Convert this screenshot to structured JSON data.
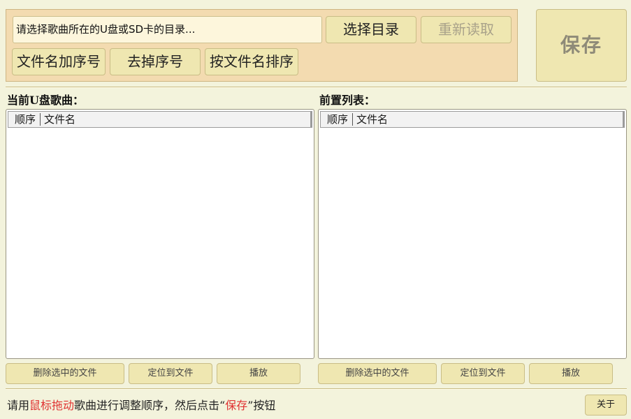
{
  "toolbar": {
    "path_text": "请选择歌曲所在的U盘或SD卡的目录...",
    "choose_dir": "选择目录",
    "reload": "重新读取",
    "add_index": "文件名加序号",
    "remove_index": "去掉序号",
    "sort_by_name": "按文件名排序",
    "save": "保存"
  },
  "left_panel": {
    "title": "当前U盘歌曲：",
    "col_order": "顺序",
    "col_name": "文件名",
    "delete_btn": "删除选中的文件",
    "locate_btn": "定位到文件",
    "play_btn": "播放"
  },
  "right_panel": {
    "title": "前置列表：",
    "col_order": "顺序",
    "col_name": "文件名",
    "delete_btn": "删除选中的文件",
    "locate_btn": "定位到文件",
    "play_btn": "播放"
  },
  "status": {
    "prefix": "请用",
    "highlight1": "鼠标拖动",
    "middle": "歌曲进行调整顺序，然后点击“",
    "highlight2": "保存",
    "suffix": "”按钮"
  },
  "about": "关于",
  "colors": {
    "background": "#f3f3dc",
    "panel": "#f3dbb0",
    "button": "#efe7b1",
    "highlight_red": "#e03232"
  }
}
